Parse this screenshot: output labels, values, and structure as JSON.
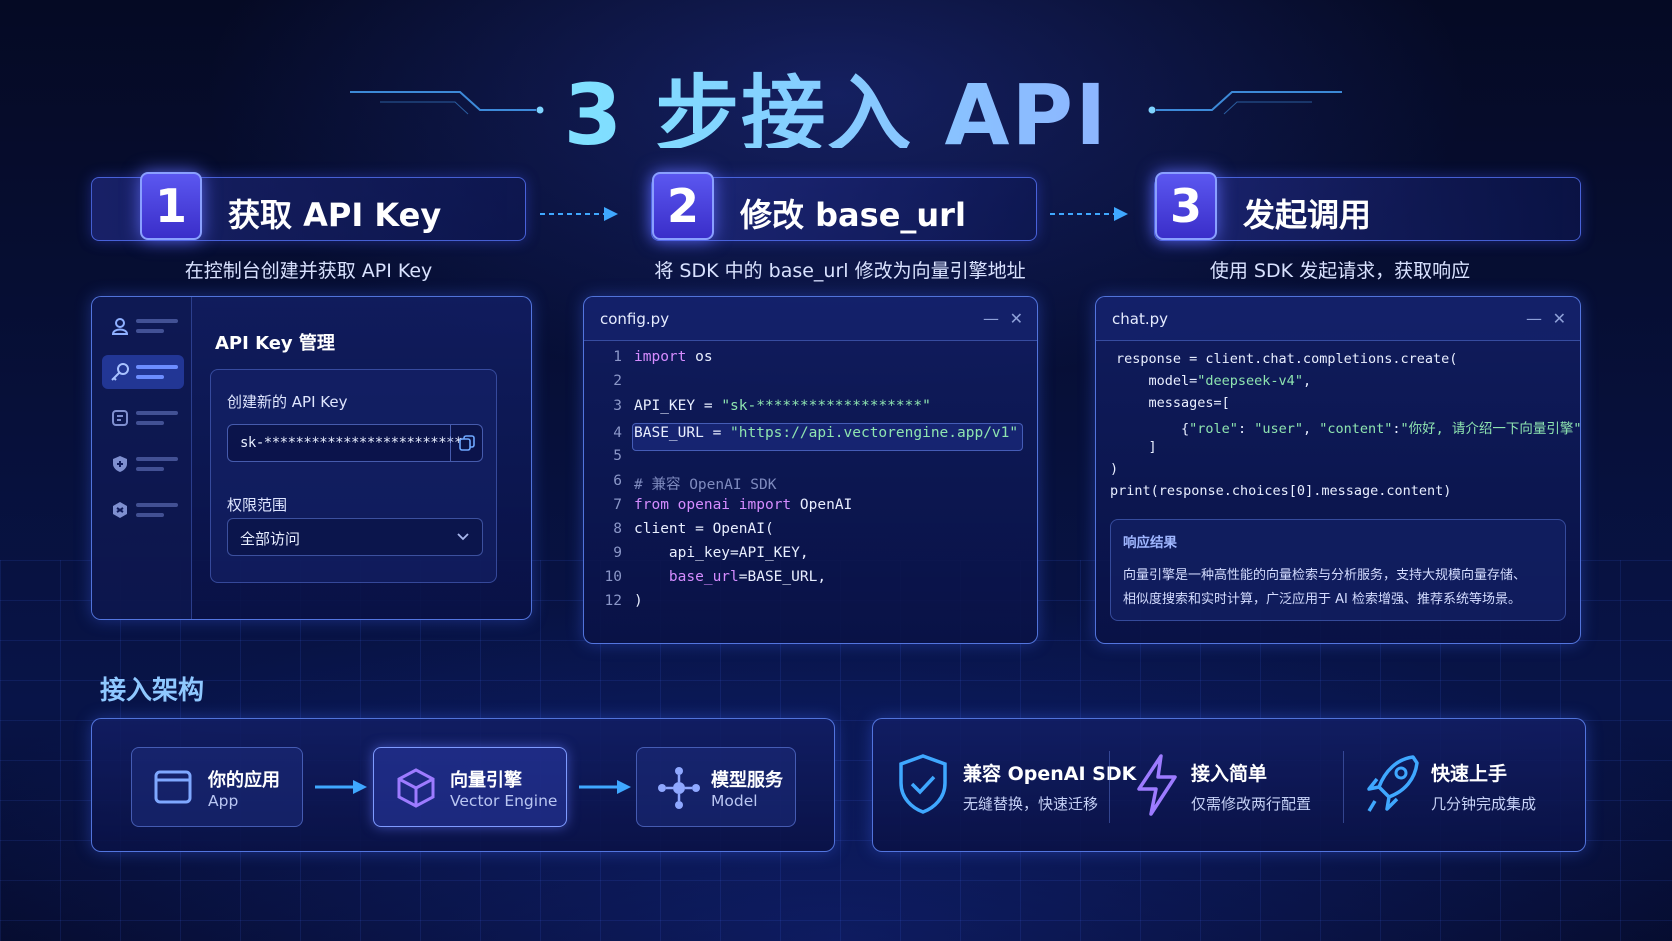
{
  "title": "3 步接入 API",
  "steps": [
    {
      "num": "1",
      "title": "获取 API Key",
      "subtitle": "在控制台创建并获取 API Key"
    },
    {
      "num": "2",
      "title": "修改 base_url",
      "subtitle": "将 SDK 中的 base_url 修改为向量引擎地址"
    },
    {
      "num": "3",
      "title": "发起调用",
      "subtitle": "使用 SDK 发起请求，获取响应"
    }
  ],
  "api_key_panel": {
    "title": "API Key 管理",
    "create_label": "创建新的 API Key",
    "key_value": "sk-*************************",
    "scope_label": "权限范围",
    "scope_value": "全部访问"
  },
  "config_panel": {
    "filename": "config.py",
    "minimize": "—",
    "close": "✕",
    "lines": [
      {
        "n": "1",
        "parts": [
          [
            "kw",
            "import"
          ],
          [
            "",
            " os"
          ]
        ]
      },
      {
        "n": "2",
        "parts": []
      },
      {
        "n": "3",
        "parts": [
          [
            "",
            "API_KEY = "
          ],
          [
            "str",
            "\"sk-*******************\""
          ]
        ]
      },
      {
        "n": "4",
        "parts": [
          [
            "",
            "BASE_URL = "
          ],
          [
            "str",
            "\"https://api.vectorengine.app/v1\""
          ]
        ]
      },
      {
        "n": "5",
        "parts": []
      },
      {
        "n": "6",
        "parts": [
          [
            "cm",
            "# 兼容 OpenAI SDK"
          ]
        ]
      },
      {
        "n": "7",
        "parts": [
          [
            "kw",
            "from"
          ],
          [
            "",
            " "
          ],
          [
            "kw",
            "openai"
          ],
          [
            "",
            " "
          ],
          [
            "kw",
            "import"
          ],
          [
            "",
            " OpenAI"
          ]
        ]
      },
      {
        "n": "8",
        "parts": [
          [
            "",
            "client = OpenAI("
          ]
        ]
      },
      {
        "n": "9",
        "parts": [
          [
            "",
            "    api_key=API_KEY,"
          ]
        ]
      },
      {
        "n": "10",
        "parts": [
          [
            "kw",
            "    base_url"
          ],
          [
            "",
            "=BASE_URL,"
          ]
        ]
      },
      {
        "n": "12",
        "parts": [
          [
            "",
            ")"
          ]
        ]
      }
    ]
  },
  "chat_panel": {
    "filename": "chat.py",
    "minimize": "—",
    "close": "✕",
    "lines": [
      [
        [
          "",
          "response = client.chat.completions.create("
        ]
      ],
      [
        [
          "",
          "    model="
        ],
        [
          "str",
          "\"deepseek-v4\""
        ],
        [
          "",
          ","
        ]
      ],
      [
        [
          "",
          "    messages=["
        ]
      ],
      [
        [
          "",
          "        {"
        ],
        [
          "str",
          "\"role\""
        ],
        [
          "",
          ": "
        ],
        [
          "str",
          "\"user\""
        ],
        [
          "",
          ", "
        ],
        [
          "str",
          "\"content\""
        ],
        [
          "",
          ":"
        ],
        [
          "str",
          "\"你好, 请介绍一下向量引擎\""
        ],
        [
          "",
          "}"
        ]
      ],
      [
        [
          "",
          "    ]"
        ]
      ],
      [
        [
          "",
          ")"
        ]
      ],
      [
        [
          "",
          "print(response.choices[0].message.content)"
        ]
      ]
    ],
    "response_title": "响应结果",
    "response_lines": [
      "向量引擎是一种高性能的向量检索与分析服务，支持大规模向量存储、",
      "相似度搜索和实时计算，广泛应用于 AI 检索增强、推荐系统等场景。"
    ]
  },
  "architecture": {
    "title": "接入架构",
    "nodes": [
      {
        "title": "你的应用",
        "subtitle": "App",
        "icon": "app-window-icon"
      },
      {
        "title": "向量引擎",
        "subtitle": "Vector Engine",
        "icon": "cube-icon"
      },
      {
        "title": "模型服务",
        "subtitle": "Model",
        "icon": "network-icon"
      }
    ]
  },
  "features": [
    {
      "title": "兼容 OpenAI SDK",
      "subtitle": "无缝替换，快速迁移",
      "icon": "shield-check-icon"
    },
    {
      "title": "接入简单",
      "subtitle": "仅需修改两行配置",
      "icon": "lightning-icon"
    },
    {
      "title": "快速上手",
      "subtitle": "几分钟完成集成",
      "icon": "rocket-icon"
    }
  ],
  "colors": {
    "accent": "#5b57f0",
    "link": "#3fa8ff",
    "string": "#8ee4b0",
    "keyword": "#d58cff"
  }
}
